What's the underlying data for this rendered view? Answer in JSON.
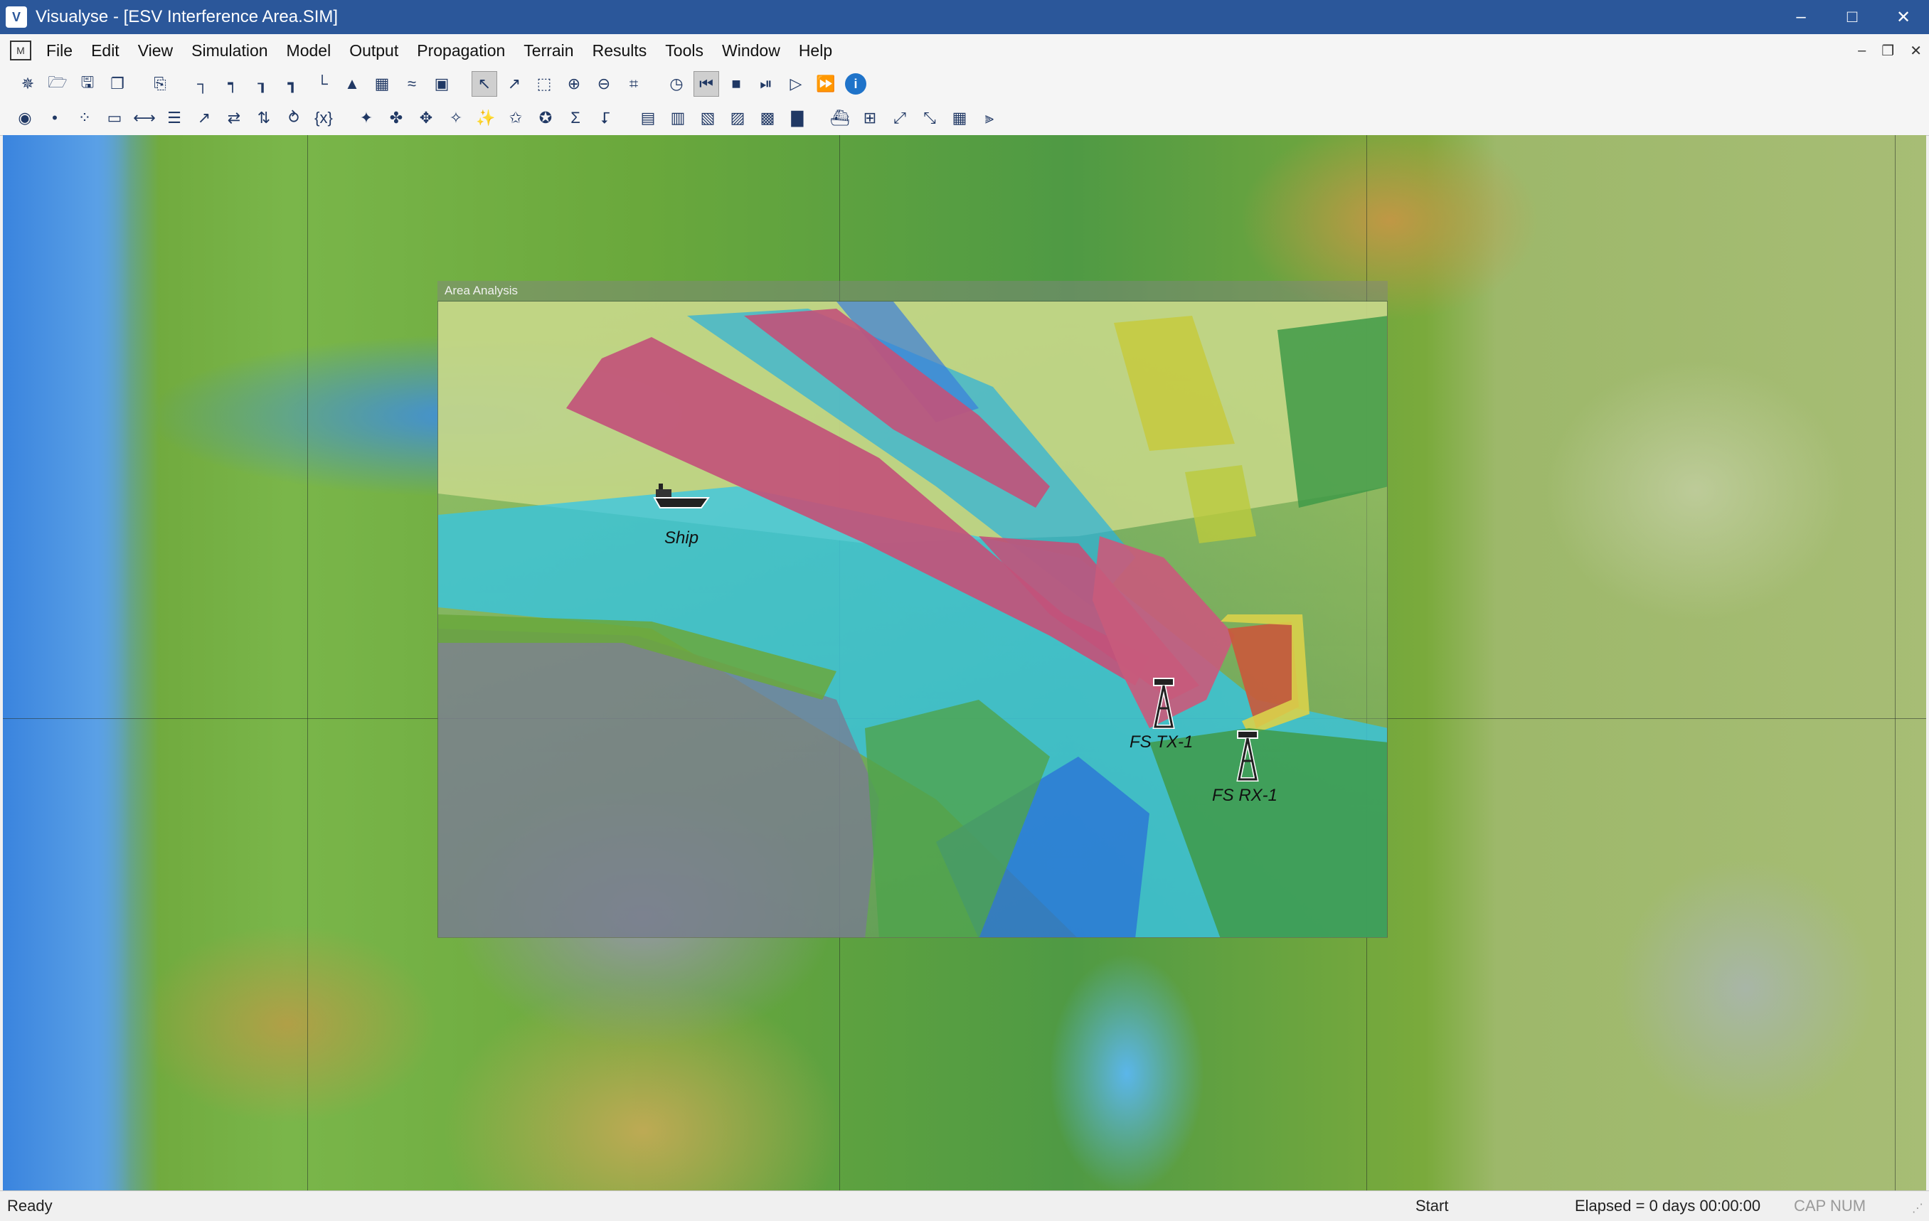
{
  "window": {
    "title": "Visualyse - [ESV Interference Area.SIM]",
    "app_icon_text": "V",
    "controls": [
      "minimize",
      "maximize",
      "close"
    ]
  },
  "menu": {
    "items": [
      "File",
      "Edit",
      "View",
      "Simulation",
      "Model",
      "Output",
      "Propagation",
      "Terrain",
      "Results",
      "Tools",
      "Window",
      "Help"
    ]
  },
  "toolbar1": {
    "icons": [
      "new-icon",
      "open-icon",
      "save-icon",
      "save-as-icon",
      "copy-icon",
      "define-icon-1",
      "define-icon-2",
      "define-icon-3",
      "define-icon-4",
      "define-icon-5",
      "define-icon-6",
      "table-icon",
      "chart-icon",
      "window-icon",
      "select-icon",
      "select-multi-icon",
      "select-area-icon",
      "zoom-in-icon",
      "zoom-out-icon",
      "zoom-fit-icon",
      "clock-icon",
      "rewind-icon",
      "stop-icon",
      "step-icon",
      "play-icon",
      "fast-forward-icon",
      "info-icon"
    ]
  },
  "toolbar2": {
    "icons": [
      "antenna-icon",
      "station-icon",
      "constellation-icon",
      "beam-icon",
      "link-icon",
      "interference-icon",
      "propagation-icon",
      "path-icon",
      "group-icon",
      "vary-icon",
      "variables-icon",
      "carrier-icon",
      "terrain-icon-1",
      "terrain-icon-2",
      "terrain-icon-3",
      "terrain-icon-4",
      "terrain-icon-5",
      "terrain-icon-6",
      "sum-icon",
      "analysis-icon",
      "area-icon-1",
      "area-icon-2",
      "area-icon-3",
      "area-icon-4",
      "area-icon-5",
      "area-icon-6",
      "ship-icon",
      "add-icon",
      "resize-icon",
      "ruler-icon",
      "mesh-icon",
      "filter-icon"
    ]
  },
  "map": {
    "area_analysis_title": "Area Analysis",
    "markers": [
      {
        "name": "Ship",
        "type": "ship"
      },
      {
        "name": "FS TX-1",
        "type": "tower"
      },
      {
        "name": "FS RX-1",
        "type": "tower"
      }
    ]
  },
  "status": {
    "ready": "Ready",
    "start": "Start",
    "elapsed": "Elapsed = 0 days 00:00:00",
    "caps": "CAP  NUM"
  }
}
